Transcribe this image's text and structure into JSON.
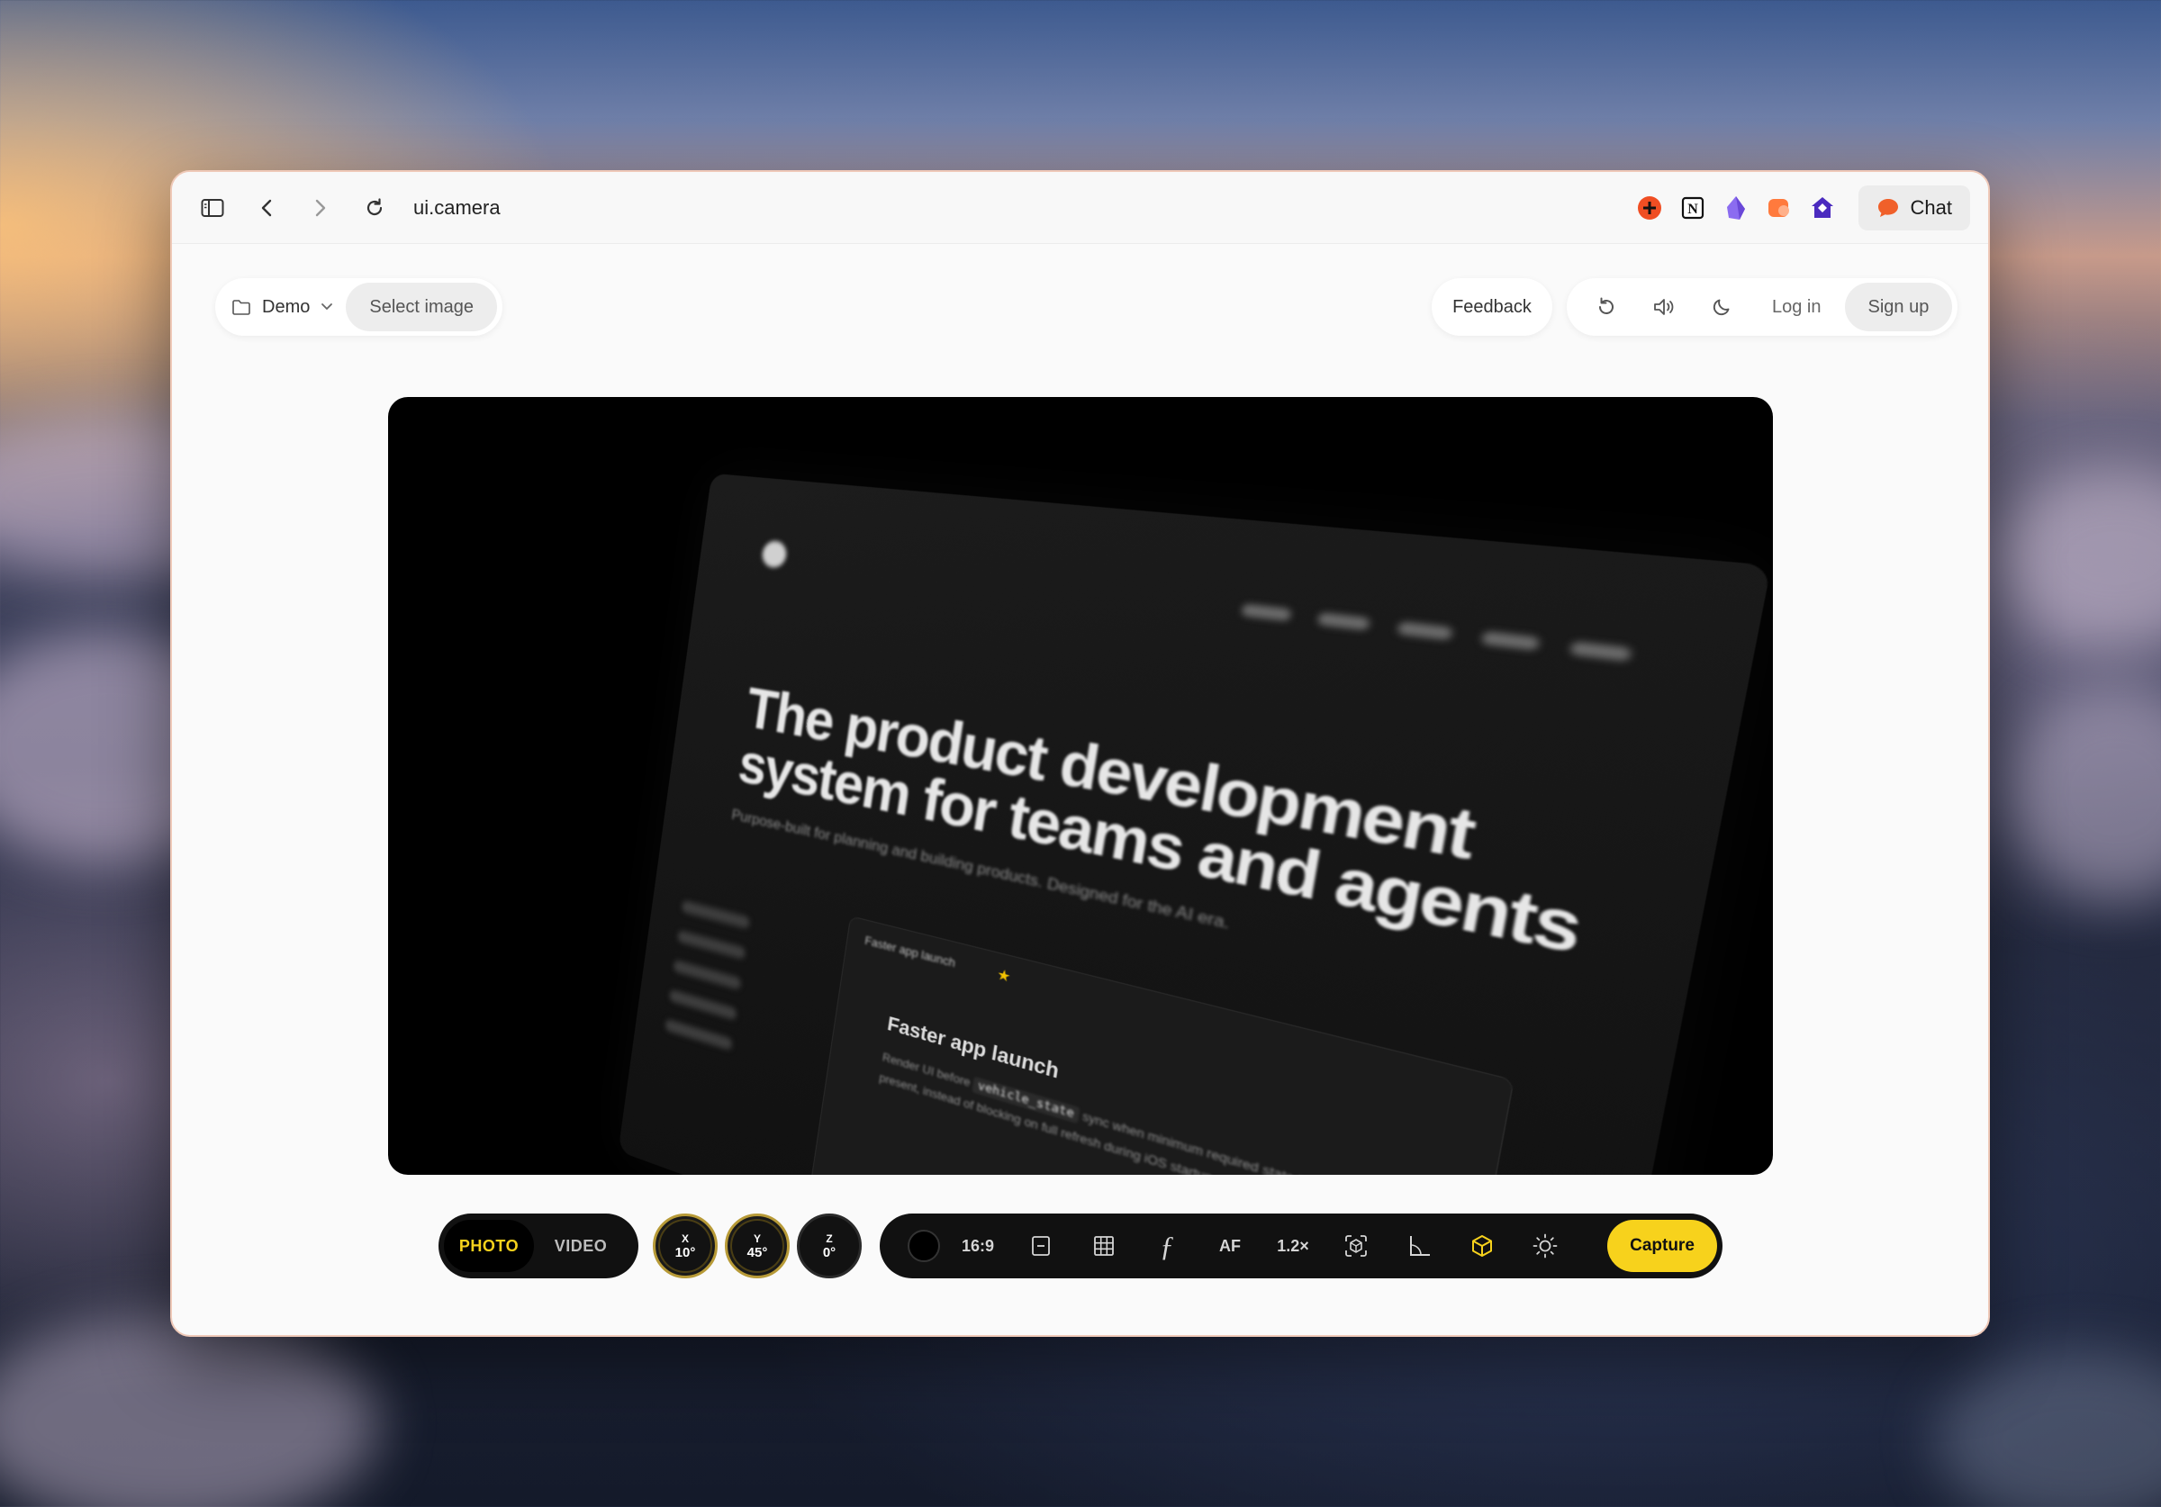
{
  "browser": {
    "url": "ui.camera",
    "chat_label": "Chat",
    "extensions": [
      "plus-circle-icon",
      "notion-icon",
      "crystal-icon",
      "orange-square-icon",
      "house-icon"
    ]
  },
  "app": {
    "demo_label": "Demo",
    "select_image_label": "Select image",
    "feedback_label": "Feedback",
    "login_label": "Log in",
    "signup_label": "Sign up"
  },
  "preview": {
    "headline_line1": "The product development",
    "headline_line2": "system for teams and agents",
    "subtitle": "Purpose-built for planning and building products. Designed for the AI era.",
    "card_tab": "Faster app launch",
    "card_title": "Faster app launch",
    "card_text_before": "Render UI before",
    "card_code": "vehicle_state",
    "card_text_after": "sync when minimum required state is present, instead of blocking on full refresh during iOS startup."
  },
  "controls": {
    "mode_photo": "PHOTO",
    "mode_video": "VIDEO",
    "active_mode": "PHOTO",
    "dials": [
      {
        "axis": "X",
        "value": "10°"
      },
      {
        "axis": "Y",
        "value": "45°"
      },
      {
        "axis": "Z",
        "value": "0°"
      }
    ],
    "aspect_ratio": "16:9",
    "autofocus": "AF",
    "zoom": "1.2×",
    "capture_label": "Capture",
    "accent_color": "#f7d21c"
  }
}
